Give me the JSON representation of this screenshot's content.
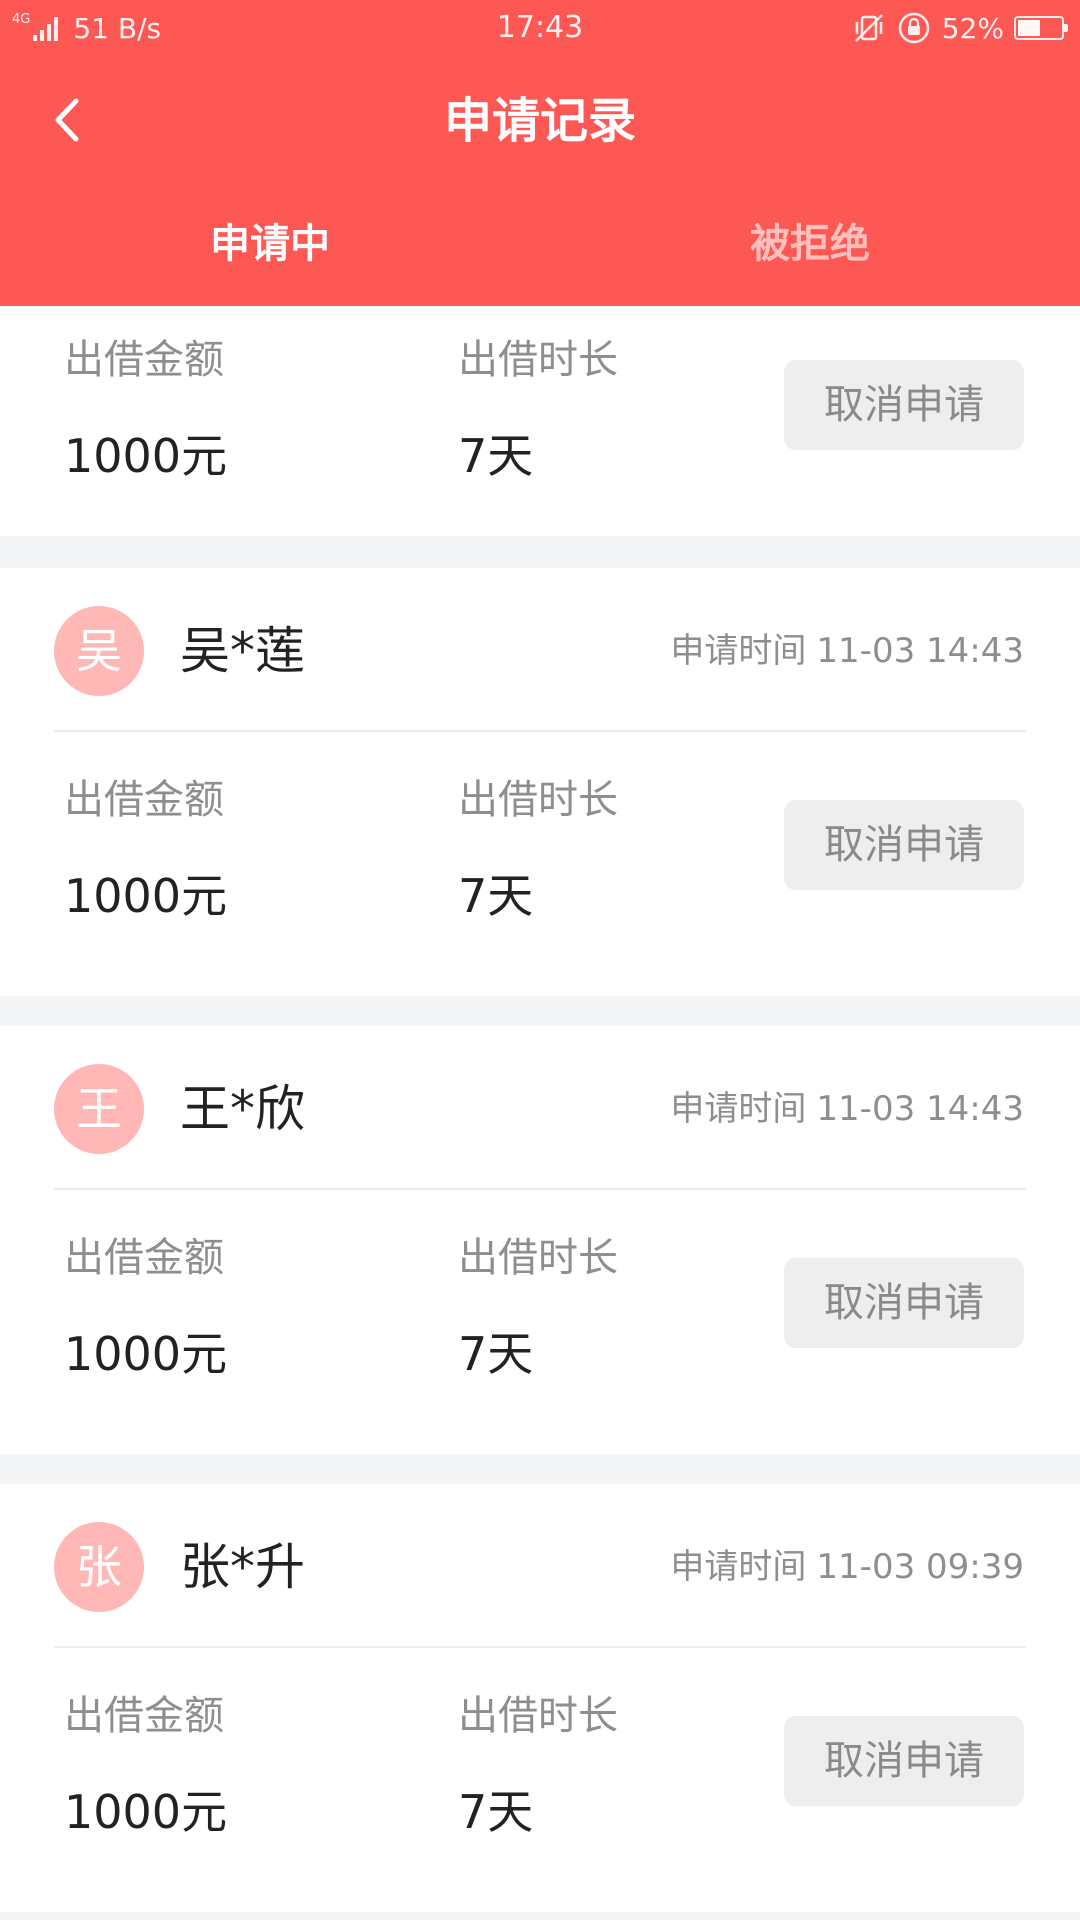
{
  "status_bar": {
    "network": "4G",
    "speed": "51 B/s",
    "time": "17:43",
    "battery_percent": "52%",
    "battery_level": 0.52,
    "icons": [
      "signal-icon",
      "vibrate-silent-icon",
      "rotation-lock-icon",
      "battery-icon"
    ]
  },
  "nav": {
    "title": "申请记录",
    "back_icon": "chevron-left-icon"
  },
  "tabs": [
    {
      "label": "申请中",
      "active": true
    },
    {
      "label": "被拒绝",
      "active": false
    }
  ],
  "colors": {
    "accent": "#fd5853",
    "avatar_bg": "#ffb8b6",
    "tab_inactive": "#ffc0bc",
    "page_bg": "#f4f5f7"
  },
  "records": [
    {
      "avatar": "",
      "name": "",
      "time_label": "",
      "time": "",
      "amount_label": "出借金额",
      "amount": "1000元",
      "duration_label": "出借时长",
      "duration": "7天",
      "cancel_label": "取消申请"
    },
    {
      "avatar": "吴",
      "name": "吴*莲",
      "time_label": "申请时间",
      "time": "11-03 14:43",
      "amount_label": "出借金额",
      "amount": "1000元",
      "duration_label": "出借时长",
      "duration": "7天",
      "cancel_label": "取消申请"
    },
    {
      "avatar": "王",
      "name": "王*欣",
      "time_label": "申请时间",
      "time": "11-03 14:43",
      "amount_label": "出借金额",
      "amount": "1000元",
      "duration_label": "出借时长",
      "duration": "7天",
      "cancel_label": "取消申请"
    },
    {
      "avatar": "张",
      "name": "张*升",
      "time_label": "申请时间",
      "time": "11-03 09:39",
      "amount_label": "出借金额",
      "amount": "1000元",
      "duration_label": "出借时长",
      "duration": "7天",
      "cancel_label": "取消申请"
    }
  ]
}
